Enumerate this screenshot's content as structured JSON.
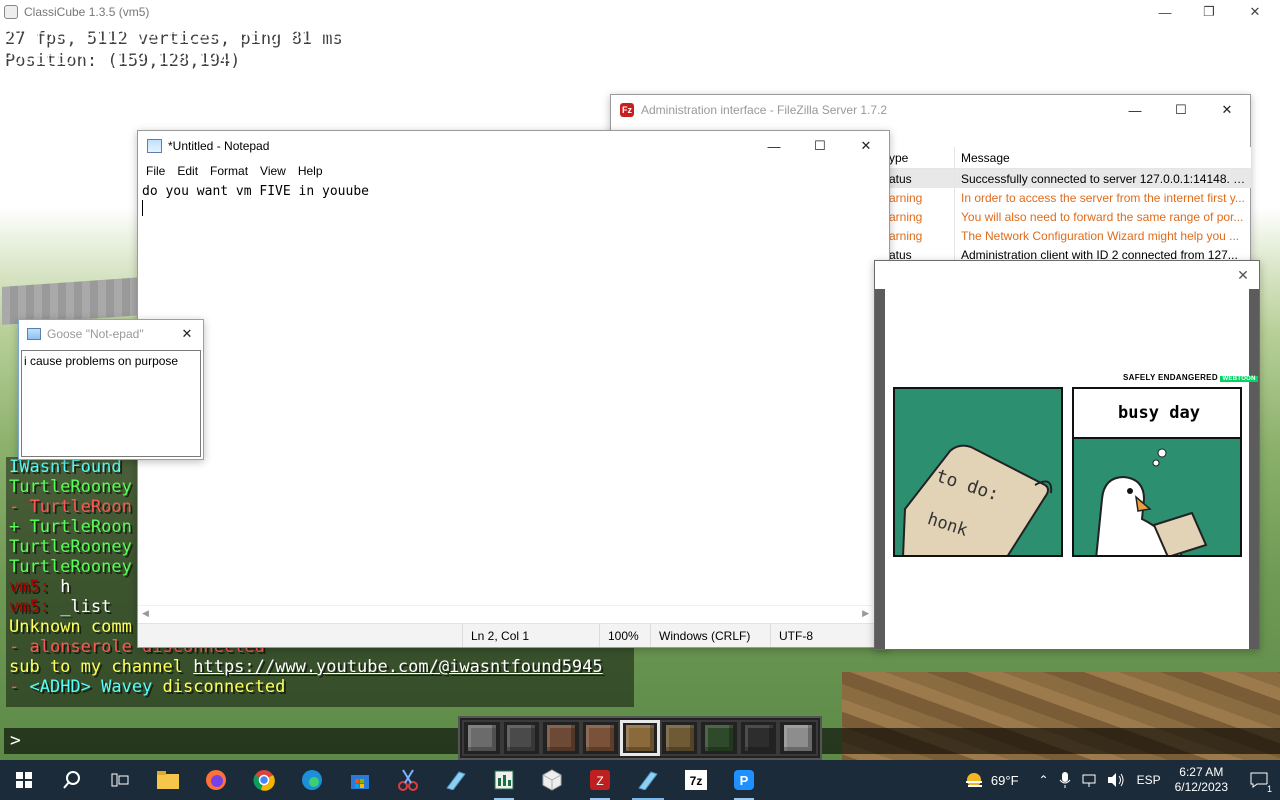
{
  "game": {
    "title": "ClassiCube 1.3.5 (vm5)",
    "hud_line1": "27 fps, 5112 vertices, ping 81 ms",
    "hud_line2": "Position: (159,128,194)",
    "chat": [
      {
        "parts": [
          {
            "text": "IWasntFound",
            "color": "aqua"
          }
        ]
      },
      {
        "parts": [
          {
            "text": "TurtleRooney",
            "color": "green"
          }
        ]
      },
      {
        "parts": [
          {
            "text": "- TurtleRoon",
            "color": "red"
          }
        ]
      },
      {
        "parts": [
          {
            "text": "+ TurtleRoon",
            "color": "green"
          }
        ]
      },
      {
        "parts": [
          {
            "text": "TurtleRooney",
            "color": "green"
          }
        ]
      },
      {
        "parts": [
          {
            "text": "TurtleRooney",
            "color": "green"
          }
        ]
      },
      {
        "parts": [
          {
            "text": "vm5:",
            "color": "dred"
          },
          {
            "text": " h",
            "color": "white"
          }
        ]
      },
      {
        "parts": [
          {
            "text": "vm5:",
            "color": "dred"
          },
          {
            "text": " _list",
            "color": "white"
          }
        ]
      },
      {
        "parts": [
          {
            "text": "Unknown comm",
            "color": "yellow"
          }
        ]
      },
      {
        "parts": [
          {
            "text": "- alonserole disconnected",
            "color": "red"
          }
        ]
      },
      {
        "parts": [
          {
            "text": "sub to my channel ",
            "color": "yellow"
          },
          {
            "text": "https://www.youtube.com/@iwasntfound5945",
            "color": "link"
          }
        ]
      },
      {
        "parts": [
          {
            "text": "- ",
            "color": "red"
          },
          {
            "text": "<ADHD> Wavey",
            "color": "aqua"
          },
          {
            "text": " disconnected",
            "color": "yellow"
          }
        ]
      }
    ],
    "chat_prompt": ">",
    "hotbar": [
      {
        "color": "#6b6b6b"
      },
      {
        "color": "#4a4a4a"
      },
      {
        "color": "#6d4a35"
      },
      {
        "color": "#7a5239"
      },
      {
        "color": "#8a6a3a",
        "selected": true
      },
      {
        "color": "#6e5a34"
      },
      {
        "color": "#2f4a2a"
      },
      {
        "color": "#2d2d2d"
      },
      {
        "color": "#8d8d8d"
      }
    ]
  },
  "filezilla": {
    "title": "Administration interface - FileZilla Server 1.7.2",
    "icon_glyph": "Fz",
    "col_type": "ype",
    "col_message": "Message",
    "rows": [
      {
        "type": "atus",
        "message": "Successfully connected to server 127.0.0.1:14148. Ser...",
        "level": "status",
        "selected": true
      },
      {
        "type": "arning",
        "message": "In order to access the server from the internet first y...",
        "level": "warning"
      },
      {
        "type": "arning",
        "message": "You will also need to forward the same range of por...",
        "level": "warning"
      },
      {
        "type": "arning",
        "message": "The Network Configuration Wizard might help you ...",
        "level": "warning"
      },
      {
        "type": "atus",
        "message": "Administration client with ID 2 connected from 127...",
        "level": "status"
      }
    ]
  },
  "notepad": {
    "title": "*Untitled - Notepad",
    "menu": [
      "File",
      "Edit",
      "Format",
      "View",
      "Help"
    ],
    "text": "do you want vm FIVE in youube",
    "status": {
      "position": "Ln 2, Col 1",
      "zoom": "100%",
      "line_ending": "Windows (CRLF)",
      "encoding": "UTF-8"
    }
  },
  "goose_notepad": {
    "title": "Goose \"Not-epad\"",
    "text": "i cause problems on purpose"
  },
  "meme": {
    "brand": "SAFELY ENDANGERED",
    "brand_tag": "WEBTOON",
    "left_title": "to do:",
    "left_item": "honk",
    "right_caption": "busy day",
    "colors": {
      "panel_bg": "#2b8f70",
      "paper": "#e2d3b6",
      "beak": "#e8a040"
    }
  },
  "taskbar": {
    "apps": [
      "start",
      "search",
      "task-view",
      "file-explorer",
      "firefox",
      "chrome",
      "edge",
      "store",
      "snipping",
      "notepad",
      "excel",
      "3d-box",
      "filezilla",
      "classicube",
      "7zip",
      "p-app"
    ],
    "weather": "69°F",
    "language": "ESP",
    "time": "6:27 AM",
    "date": "6/12/2023",
    "notifications": "1"
  }
}
